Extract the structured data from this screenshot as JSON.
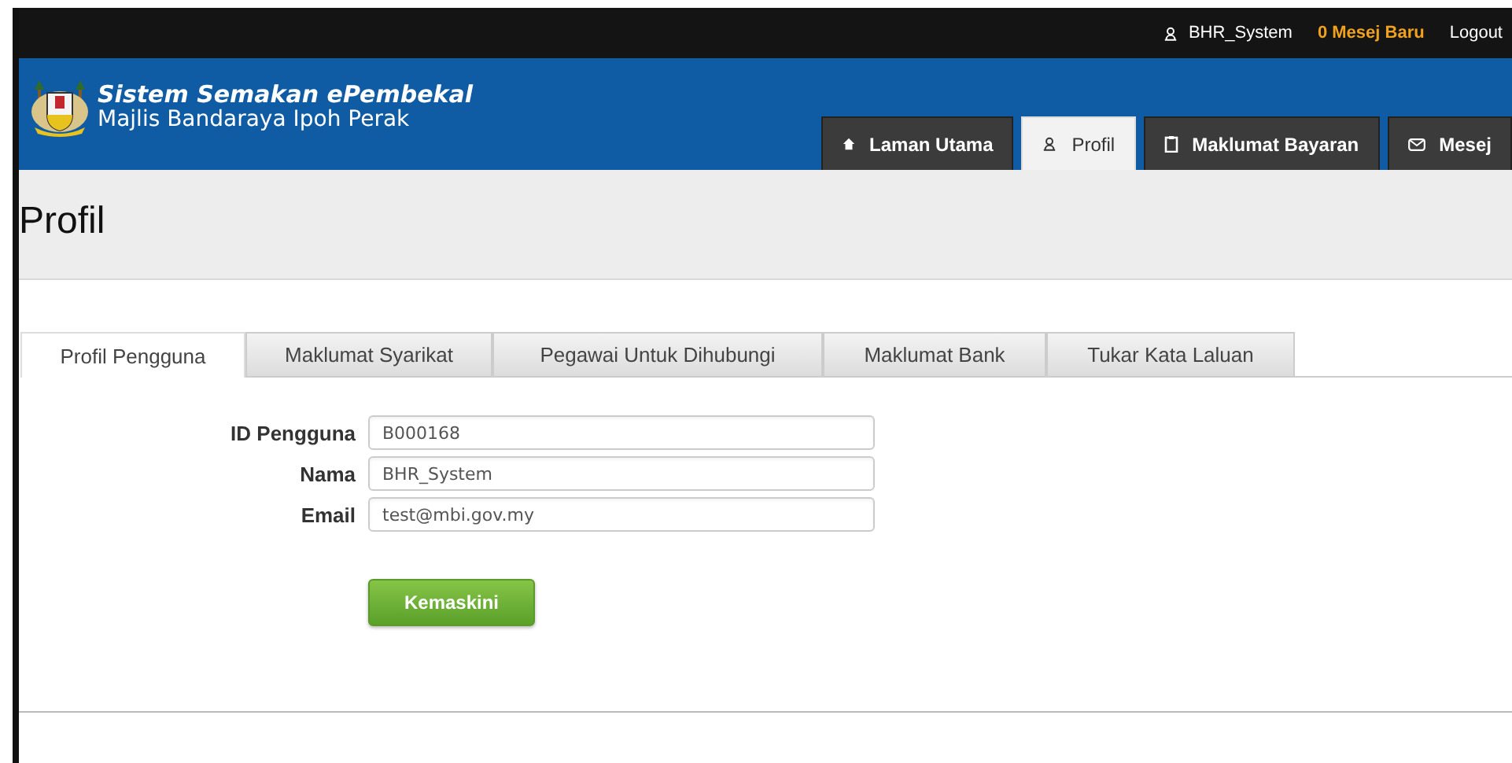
{
  "topbar": {
    "user": "BHR_System",
    "messages": "0 Mesej Baru",
    "logout": "Logout"
  },
  "header": {
    "title": "Sistem Semakan ePembekal",
    "subtitle": "Majlis Bandaraya Ipoh Perak"
  },
  "nav": [
    {
      "label": "Laman Utama",
      "selected": false
    },
    {
      "label": "Profil",
      "selected": true
    },
    {
      "label": "Maklumat Bayaran",
      "selected": false
    },
    {
      "label": "Mesej",
      "selected": false
    }
  ],
  "page_title": "Profil",
  "tabs": [
    {
      "label": "Profil Pengguna",
      "selected": true
    },
    {
      "label": "Maklumat Syarikat",
      "selected": false
    },
    {
      "label": "Pegawai Untuk Dihubungi",
      "selected": false
    },
    {
      "label": "Maklumat Bank",
      "selected": false
    },
    {
      "label": "Tukar Kata Laluan",
      "selected": false
    }
  ],
  "form": {
    "fields": [
      {
        "label": "ID Pengguna",
        "value": "B000168"
      },
      {
        "label": "Nama",
        "value": "BHR_System"
      },
      {
        "label": "Email",
        "value": "test@mbi.gov.my"
      }
    ],
    "submit": "Kemaskini"
  }
}
